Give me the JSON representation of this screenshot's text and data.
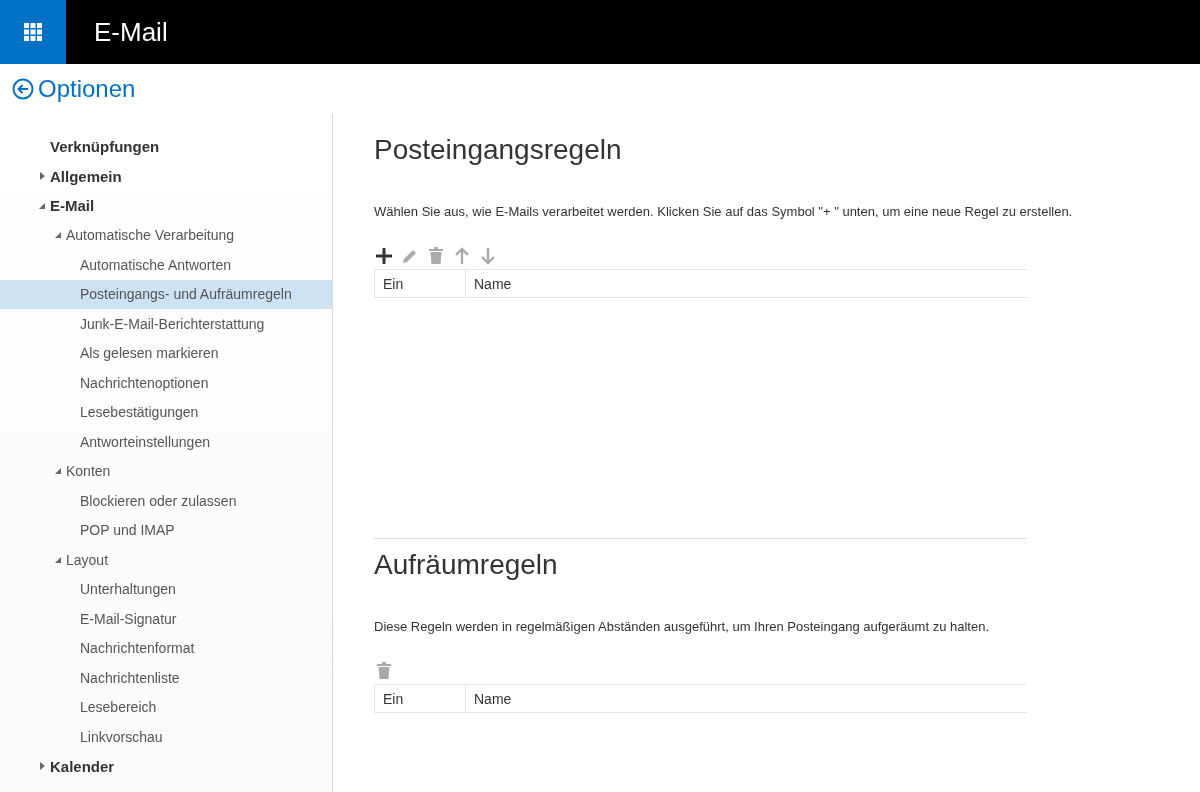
{
  "header": {
    "title": "E-Mail"
  },
  "page_title": "Optionen",
  "sidebar": {
    "items": [
      {
        "label": "Verknüpfungen",
        "selected": false
      },
      {
        "label": "Allgemein",
        "expanded": false,
        "selected": false
      },
      {
        "label": "E-Mail",
        "expanded": true,
        "selected": false,
        "children": [
          {
            "label": "Automatische Verarbeitung",
            "expanded": true,
            "selected": false,
            "children": [
              {
                "label": "Automatische Antworten",
                "selected": false
              },
              {
                "label": "Posteingangs- und Aufräumregeln",
                "selected": true
              },
              {
                "label": "Junk-E-Mail-Berichterstattung",
                "selected": false
              },
              {
                "label": "Als gelesen markieren",
                "selected": false
              },
              {
                "label": "Nachrichtenoptionen",
                "selected": false
              },
              {
                "label": "Lesebestätigungen",
                "selected": false
              },
              {
                "label": "Antworteinstellungen",
                "selected": false
              }
            ]
          },
          {
            "label": "Konten",
            "expanded": true,
            "selected": false,
            "children": [
              {
                "label": "Blockieren oder zulassen",
                "selected": false
              },
              {
                "label": "POP und IMAP",
                "selected": false
              }
            ]
          },
          {
            "label": "Layout",
            "expanded": true,
            "selected": false,
            "children": [
              {
                "label": "Unterhaltungen",
                "selected": false
              },
              {
                "label": "E-Mail-Signatur",
                "selected": false
              },
              {
                "label": "Nachrichtenformat",
                "selected": false
              },
              {
                "label": "Nachrichtenliste",
                "selected": false
              },
              {
                "label": "Lesebereich",
                "selected": false
              },
              {
                "label": "Linkvorschau",
                "selected": false
              }
            ]
          }
        ]
      },
      {
        "label": "Kalender",
        "expanded": false,
        "selected": false
      }
    ]
  },
  "sections": [
    {
      "title": "Posteingangsregeln",
      "description": "Wählen Sie aus, wie E-Mails verarbeitet werden. Klicken Sie auf das Symbol \"+ \" unten, um eine neue Regel zu erstellen.",
      "toolbar": [
        {
          "kind": "add",
          "disabled": false
        },
        {
          "kind": "edit",
          "disabled": true
        },
        {
          "kind": "delete",
          "disabled": true
        },
        {
          "kind": "up",
          "disabled": true
        },
        {
          "kind": "down",
          "disabled": true
        }
      ],
      "table": {
        "columns": [
          "Ein",
          "Name"
        ]
      }
    },
    {
      "title": "Aufräumregeln",
      "description": "Diese Regeln werden in regelmäßigen Abständen ausgeführt, um Ihren Posteingang aufgeräumt zu halten.",
      "toolbar": [
        {
          "kind": "delete",
          "disabled": true
        }
      ],
      "table": {
        "columns": [
          "Ein",
          "Name"
        ]
      }
    }
  ]
}
